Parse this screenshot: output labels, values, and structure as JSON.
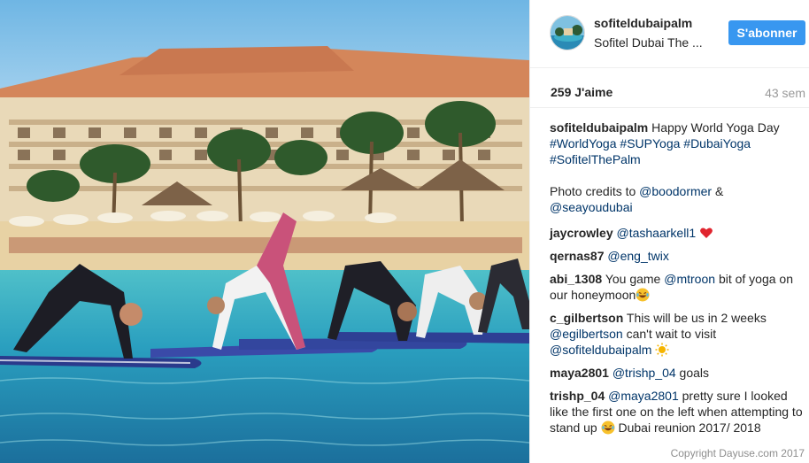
{
  "post": {
    "username": "sofiteldubaipalm",
    "location": "Sofitel Dubai The ...",
    "follow_label": "S'abonner",
    "likes": "259 J'aime",
    "time_ago": "43 sem"
  },
  "caption": {
    "author": "sofiteldubaipalm",
    "text": "Happy World Yoga Day",
    "hashtags": [
      "#WorldYoga",
      "#SUPYoga",
      "#DubaiYoga",
      "#SofitelThePalm"
    ],
    "credits_text": "Photo credits to",
    "credit_user_1": "@boodormer",
    "credits_and": "&",
    "credit_user_2": "@seayoudubai"
  },
  "comments": [
    {
      "author": "jaycrowley",
      "mention": "@tashaarkell1",
      "emoji": "heart"
    },
    {
      "author": "qernas87",
      "mention": "@eng_twix"
    },
    {
      "author": "abi_1308",
      "text_before": "You game",
      "mention": "@mtroon",
      "text_after": "bit of yoga on our honeymoon",
      "emoji": "laughing"
    },
    {
      "author": "c_gilbertson",
      "text_before": "This will be us in 2 weeks",
      "mention": "@egilbertson",
      "text_after": "can't wait to visit",
      "mention2": "@sofiteldubaipalm",
      "emoji": "sun"
    },
    {
      "author": "maya2801",
      "mention": "@trishp_04",
      "text_after": "goals"
    },
    {
      "author": "trishp_04",
      "mention": "@maya2801",
      "text_after": "pretty sure I looked like the first one on the left when attempting to stand up",
      "emoji": "laughing",
      "text_end": "Dubai reunion 2017/ 2018"
    }
  ],
  "watermark": "Copyright Dayuse.com 2017",
  "colors": {
    "accent": "#3897f0",
    "link": "#003569",
    "sky": "#8fc6ea",
    "sea": "#2b9bbd",
    "sand": "#e8d2a4"
  }
}
